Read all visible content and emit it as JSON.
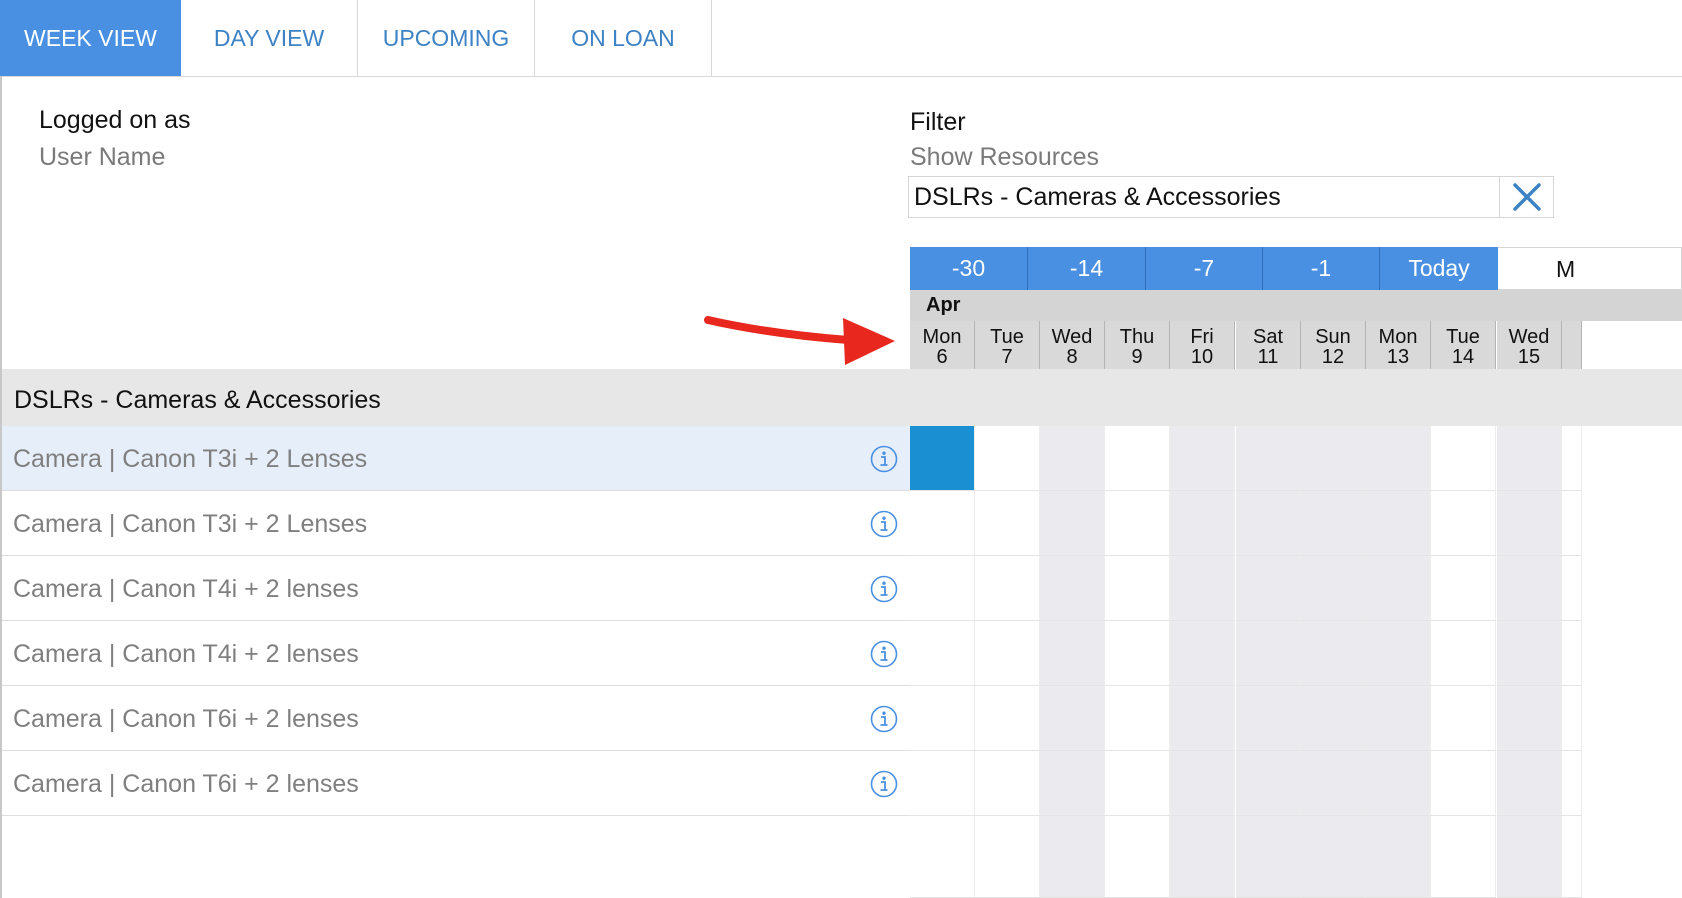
{
  "tabs": [
    {
      "label": "WEEK VIEW",
      "active": true
    },
    {
      "label": "DAY VIEW",
      "active": false
    },
    {
      "label": "UPCOMING",
      "active": false
    },
    {
      "label": "ON LOAN",
      "active": false
    }
  ],
  "user": {
    "heading": "Logged on as",
    "name": "User Name"
  },
  "filter": {
    "heading": "Filter",
    "subheading": "Show Resources",
    "value": "DSLRs - Cameras & Accessories",
    "clear_icon": "close-icon"
  },
  "date_nav": {
    "buttons": [
      "-30",
      "-14",
      "-7",
      "-1",
      "Today"
    ],
    "next_partial": "M"
  },
  "calendar": {
    "month": "Apr",
    "days": [
      {
        "dow": "Mon",
        "date": "6"
      },
      {
        "dow": "Tue",
        "date": "7"
      },
      {
        "dow": "Wed",
        "date": "8"
      },
      {
        "dow": "Thu",
        "date": "9"
      },
      {
        "dow": "Fri",
        "date": "10"
      },
      {
        "dow": "Sat",
        "date": "11"
      },
      {
        "dow": "Sun",
        "date": "12"
      },
      {
        "dow": "Mon",
        "date": "13"
      },
      {
        "dow": "Tue",
        "date": "14"
      },
      {
        "dow": "Wed",
        "date": "15"
      }
    ]
  },
  "group": {
    "title": "DSLRs - Cameras & Accessories"
  },
  "resources": [
    {
      "name": "Camera | Canon T3i + 2 Lenses",
      "selected": true
    },
    {
      "name": "Camera | Canon T3i + 2 Lenses",
      "selected": false
    },
    {
      "name": "Camera | Canon T4i + 2 lenses",
      "selected": false
    },
    {
      "name": "Camera | Canon T4i + 2 lenses",
      "selected": false
    },
    {
      "name": "Camera | Canon T6i + 2 lenses",
      "selected": false
    },
    {
      "name": "Camera | Canon T6i + 2 lenses",
      "selected": false
    }
  ],
  "colors": {
    "accent": "#4a90e2",
    "booking": "#1a8fd1",
    "annotation_arrow": "#e8271f"
  }
}
